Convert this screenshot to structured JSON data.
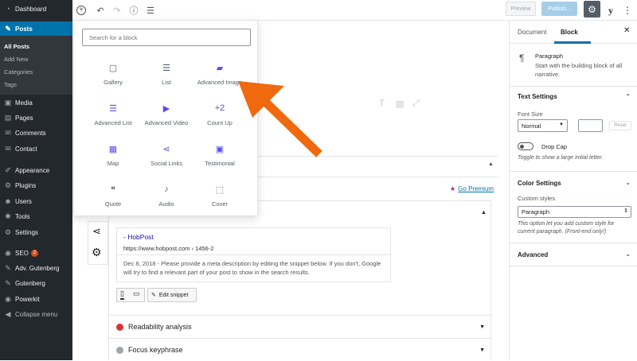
{
  "sidebar": {
    "items": [
      {
        "label": "Dashboard",
        "icon": "dashboard-icon",
        "glyph": "◔"
      },
      {
        "label": "Posts",
        "icon": "pin-icon",
        "glyph": "✎"
      },
      {
        "label": "Media",
        "icon": "media-icon",
        "glyph": "▣"
      },
      {
        "label": "Pages",
        "icon": "pages-icon",
        "glyph": "▤"
      },
      {
        "label": "Comments",
        "icon": "comment-icon",
        "glyph": "✉"
      },
      {
        "label": "Contact",
        "icon": "mail-icon",
        "glyph": "✉"
      },
      {
        "label": "Appearance",
        "icon": "brush-icon",
        "glyph": "✐"
      },
      {
        "label": "Plugins",
        "icon": "plugin-icon",
        "glyph": "⚙"
      },
      {
        "label": "Users",
        "icon": "users-icon",
        "glyph": "☻"
      },
      {
        "label": "Tools",
        "icon": "wrench-icon",
        "glyph": "✱"
      },
      {
        "label": "Settings",
        "icon": "settings-icon",
        "glyph": "⚙"
      },
      {
        "label": "SEO",
        "icon": "seo-icon",
        "glyph": "◉",
        "badge": "2"
      },
      {
        "label": "Adv. Gutenberg",
        "icon": "pencil-icon",
        "glyph": "✎"
      },
      {
        "label": "Gutenberg",
        "icon": "pencil-icon",
        "glyph": "✎"
      },
      {
        "label": "Powerkit",
        "icon": "powerkit-icon",
        "glyph": "◉"
      },
      {
        "label": "Collapse menu",
        "icon": "collapse-icon",
        "glyph": "◀"
      }
    ],
    "posts_sub": [
      "All Posts",
      "Add New",
      "Categories",
      "Tags"
    ]
  },
  "topbar": {
    "preview": "Preview",
    "publish": "Publish..."
  },
  "inserter": {
    "search_placeholder": "Search for a block",
    "blocks": [
      {
        "label": "Gallery",
        "glyph": "▢",
        "color": "#555d66",
        "icon": "gallery-icon"
      },
      {
        "label": "List",
        "glyph": "☰",
        "color": "#555d66",
        "icon": "list-icon"
      },
      {
        "label": "Advanced Image",
        "glyph": "▰",
        "color": "#5b4de8",
        "icon": "advanced-image-icon"
      },
      {
        "label": "Advanced List",
        "glyph": "☰",
        "color": "#5b4de8",
        "icon": "advanced-list-icon"
      },
      {
        "label": "Advanced Video",
        "glyph": "▶",
        "color": "#5b4de8",
        "icon": "advanced-video-icon"
      },
      {
        "label": "Count Up",
        "glyph": "+2",
        "color": "#5b4de8",
        "icon": "count-up-icon"
      },
      {
        "label": "Map",
        "glyph": "▦",
        "color": "#5b4de8",
        "icon": "map-icon"
      },
      {
        "label": "Social Links",
        "glyph": "⋖",
        "color": "#5b4de8",
        "icon": "share-icon"
      },
      {
        "label": "Testimonial",
        "glyph": "▣",
        "color": "#5b4de8",
        "icon": "testimonial-icon"
      },
      {
        "label": "Quote",
        "glyph": "❝",
        "color": "#555d66",
        "icon": "quote-icon"
      },
      {
        "label": "Audio",
        "glyph": "♪",
        "color": "#555d66",
        "icon": "audio-icon"
      },
      {
        "label": "Cover",
        "glyph": "⬚",
        "color": "#555d66",
        "icon": "cover-icon"
      }
    ]
  },
  "right_panel": {
    "tab_document": "Document",
    "tab_block": "Block",
    "block_name": "Paragraph",
    "block_desc": "Start with the building block of all narrative.",
    "text_settings": "Text Settings",
    "font_size_label": "Font Size",
    "font_size_value": "Normal",
    "reset": "Reset",
    "drop_cap": "Drop Cap",
    "drop_cap_help": "Toggle to show a large initial letter.",
    "color_settings": "Color Settings",
    "custom_styles_label": "Custom styles",
    "custom_styles_value": "Paragraph",
    "custom_styles_help": "This option let you add custom style for current paragraph. (Front-end only!)",
    "advanced": "Advanced"
  },
  "seo": {
    "go_premium": "Go Premium",
    "snippet_title": "- HobPost",
    "snippet_url": "https://www.hobpost.com › 1456-2",
    "snippet_desc": "Dec 8, 2018 - Please provide a meta description by editing the snippet below. If you don't, Google will try to find a relevant part of your post to show in the search results.",
    "edit_snippet": "Edit snippet",
    "readability": "Readability analysis",
    "focus": "Focus keyphrase",
    "readability_color": "#dc3232",
    "focus_color": "#a0a5aa"
  },
  "accent": "#0073aa",
  "arrow_color": "#f0690f"
}
